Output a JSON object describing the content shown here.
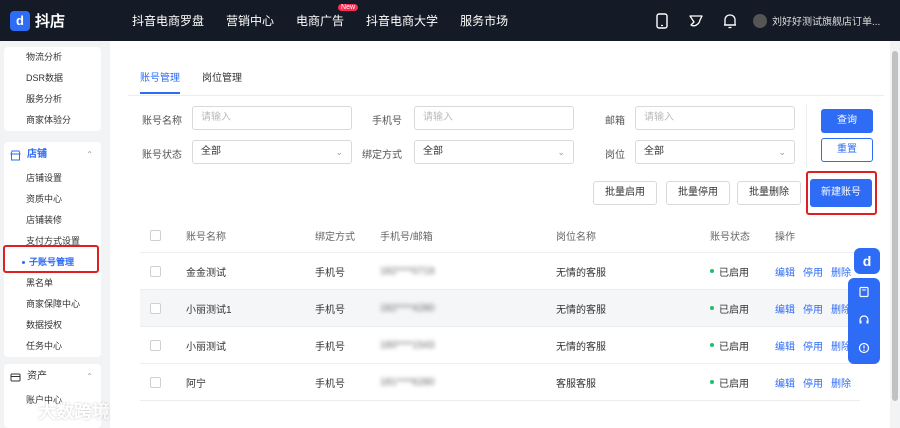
{
  "topbar": {
    "logo_text": "抖店",
    "nav": [
      {
        "label": "抖音电商罗盘"
      },
      {
        "label": "营销中心"
      },
      {
        "label": "电商广告",
        "badge": "New"
      },
      {
        "label": "抖音电商大学"
      },
      {
        "label": "服务市场"
      }
    ],
    "user_name": "刘好好测试旗舰店订单..."
  },
  "sidebar": {
    "group1_items": [
      "物流分析",
      "DSR数据",
      "服务分析",
      "商家体验分"
    ],
    "store_section": "店铺",
    "store_items": [
      "店铺设置",
      "资质中心",
      "店铺装修",
      "支付方式设置",
      "子账号管理",
      "黑名单",
      "商家保障中心",
      "数据授权",
      "任务中心"
    ],
    "active_item": "子账号管理",
    "assets_section": "资产",
    "assets_items": [
      "账户中心"
    ]
  },
  "tabs": [
    {
      "label": "账号管理",
      "active": true
    },
    {
      "label": "岗位管理",
      "active": false
    }
  ],
  "filters": {
    "account_name_label": "账号名称",
    "account_name_placeholder": "请输入",
    "phone_label": "手机号",
    "phone_placeholder": "请输入",
    "email_label": "邮箱",
    "email_placeholder": "请输入",
    "status_label": "账号状态",
    "status_value": "全部",
    "bind_label": "绑定方式",
    "bind_value": "全部",
    "post_label": "岗位",
    "post_value": "全部"
  },
  "buttons": {
    "query": "查询",
    "reset": "重置",
    "batch_enable": "批量启用",
    "batch_disable": "批量停用",
    "batch_delete": "批量删除",
    "new_account": "新建账号"
  },
  "table": {
    "headers": [
      "账号名称",
      "绑定方式",
      "手机号/邮箱",
      "岗位名称",
      "账号状态",
      "操作"
    ],
    "rows": [
      {
        "name": "金金测试",
        "bind": "手机号",
        "contact": "182****0719",
        "post": "无情的客服",
        "status": "已启用",
        "actions": [
          "编辑",
          "停用",
          "删除"
        ]
      },
      {
        "name": "小丽测试1",
        "bind": "手机号",
        "contact": "182****4280",
        "post": "无情的客服",
        "status": "已启用",
        "actions": [
          "编辑",
          "停用",
          "删除"
        ]
      },
      {
        "name": "小丽测试",
        "bind": "手机号",
        "contact": "180****1543",
        "post": "无情的客服",
        "status": "已启用",
        "actions": [
          "编辑",
          "停用",
          "删除"
        ]
      },
      {
        "name": "阿宁",
        "bind": "手机号",
        "contact": "181****6280",
        "post": "客服客服",
        "status": "已启用",
        "actions": [
          "编辑",
          "停用",
          "删除"
        ]
      }
    ]
  },
  "watermark": "大数跨境",
  "colors": {
    "accent": "#2e6cf6",
    "topbar": "#151b26",
    "success": "#1fbf6b",
    "highlight": "#e02020"
  },
  "icons": [
    "phone-icon",
    "bird-icon",
    "bell-icon",
    "book-icon",
    "headset-icon",
    "alert-icon"
  ]
}
